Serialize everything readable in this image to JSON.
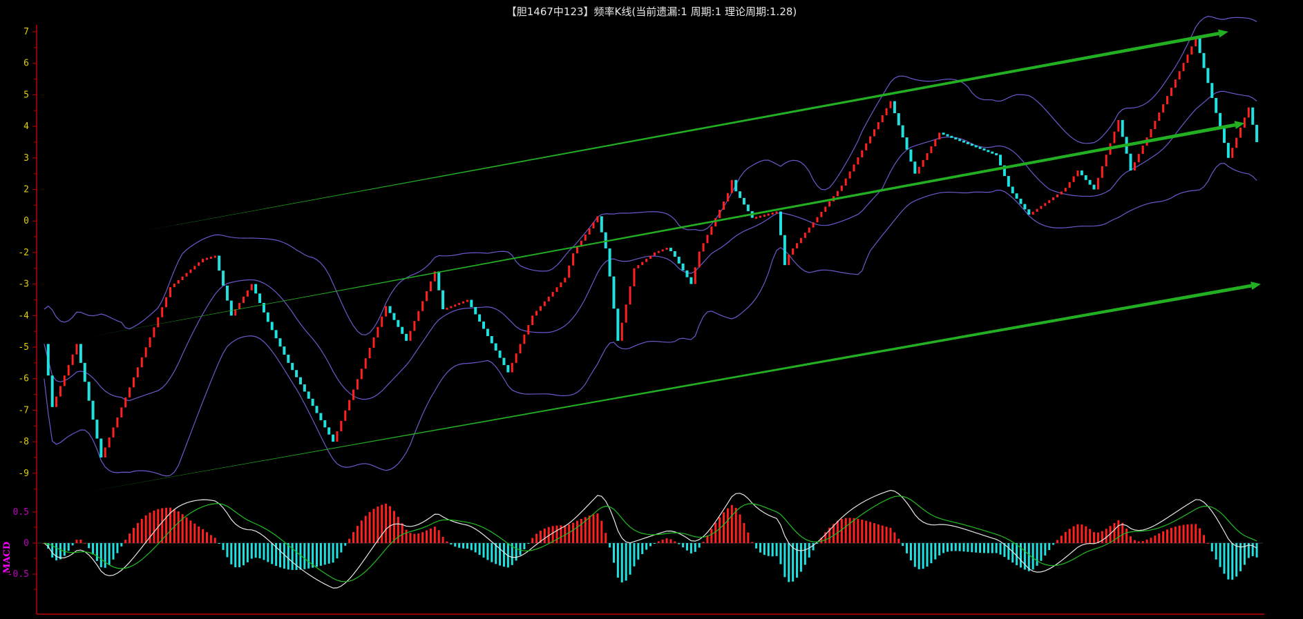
{
  "title": "【胆1467中123】频率K线(当前遗漏:1 周期:1 理论周期:1.28)",
  "chart_data": {
    "type": "candlestick",
    "title": "【胆1467中123】频率K线(当前遗漏:1 周期:1 理论周期:1.28)",
    "y_ticks": [
      "7",
      "6",
      "5",
      "4",
      "3",
      "2",
      "0",
      "-2",
      "-3",
      "-4",
      "-5",
      "-6",
      "-7",
      "-8",
      "-9"
    ],
    "y_tick_values": [
      7,
      6,
      5,
      4,
      3,
      2,
      0,
      -2,
      -3,
      -4,
      -5,
      -6,
      -7,
      -8,
      -9
    ],
    "x_range": [
      0,
      300
    ],
    "price_path": [
      [
        1,
        -4.9
      ],
      [
        3,
        -6.9
      ],
      [
        9,
        -4.9
      ],
      [
        15,
        -8.5
      ],
      [
        32,
        -3.1
      ],
      [
        40,
        -2.2
      ],
      [
        43,
        -2.1
      ],
      [
        47,
        -4.0
      ],
      [
        52,
        -3.0
      ],
      [
        56,
        -4.2
      ],
      [
        61,
        -5.5
      ],
      [
        72,
        -8.0
      ],
      [
        85,
        -3.7
      ],
      [
        90,
        -4.8
      ],
      [
        97,
        -2.6
      ],
      [
        99,
        -3.8
      ],
      [
        105,
        -3.5
      ],
      [
        115,
        -5.8
      ],
      [
        121,
        -4.0
      ],
      [
        129,
        -2.8
      ],
      [
        137,
        0.3
      ],
      [
        142,
        -4.8
      ],
      [
        146,
        -2.5
      ],
      [
        154,
        -1.7
      ],
      [
        160,
        -3.0
      ],
      [
        170,
        2.3
      ],
      [
        175,
        0.2
      ],
      [
        181,
        0.6
      ],
      [
        183,
        -2.4
      ],
      [
        196,
        1.9
      ],
      [
        209,
        4.8
      ],
      [
        215,
        2.5
      ],
      [
        221,
        3.8
      ],
      [
        235,
        3.1
      ],
      [
        243,
        0.4
      ],
      [
        255,
        2.6
      ],
      [
        259,
        2.0
      ],
      [
        265,
        4.2
      ],
      [
        268,
        2.6
      ],
      [
        284,
        6.8
      ],
      [
        292,
        3.0
      ],
      [
        297,
        4.6
      ],
      [
        299,
        3.5
      ]
    ],
    "trend_lines": [
      {
        "from": [
          24,
          -0.7
        ],
        "to": [
          292,
          7.0
        ]
      },
      {
        "from": [
          11,
          -4.7
        ],
        "to": [
          296,
          4.1
        ]
      },
      {
        "from": [
          11,
          -9.6
        ],
        "to": [
          300,
          -3.0
        ]
      }
    ],
    "indicator": {
      "name": "MACD",
      "y_ticks": [
        "0.5",
        "0",
        "-0.5"
      ],
      "y_tick_values": [
        0.5,
        0,
        -0.5
      ]
    },
    "colors": {
      "up": "#ff2020",
      "down": "#20e0e0",
      "band": "#6a5acd",
      "dif": "#e8e8e8",
      "dea": "#20c020",
      "trend": "#22b022",
      "axis": "#c00000",
      "tick": "#e0d000",
      "macd_label": "#c000c0"
    }
  }
}
